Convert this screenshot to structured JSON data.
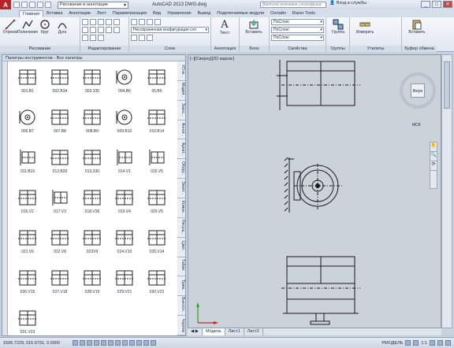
{
  "app": {
    "logo": "A",
    "title": "AutoCAD 2013  DWG.dwg",
    "workspace": "Рисование и аннотации",
    "search_placeholder": "Введите ключевое слово/фразу",
    "signin": "Вход в службы"
  },
  "tabs": [
    "Главная",
    "Вставка",
    "Аннотации",
    "Лист",
    "Параметризация",
    "Вид",
    "Управление",
    "Вывод",
    "Подключаемые модули",
    "Онлайн",
    "Razer Tools"
  ],
  "ribbon": {
    "draw": {
      "title": "Рисование",
      "tools": [
        "Отрезок",
        "Полилиния",
        "Круг",
        "Дуга"
      ]
    },
    "modify": {
      "title": "Редактирование"
    },
    "layers": {
      "title": "Слои",
      "config": "Несохраненная конфигурация сло"
    },
    "annotation": {
      "title": "Аннотация",
      "tool": "Текст"
    },
    "block": {
      "title": "Блок",
      "tool": "Вставить"
    },
    "properties": {
      "title": "Свойства",
      "layer": "ПоСлою",
      "linetype": "ПоСлою",
      "lineweight": "ПоСлою"
    },
    "groups": {
      "title": "Группы",
      "tool": "Группа"
    },
    "utilities": {
      "title": "Утилиты",
      "tool": "Измерить"
    },
    "clipboard": {
      "title": "Буфер обмена",
      "tool": "Вставить"
    }
  },
  "palette": {
    "header": "Палитры инструментов - Все палитры",
    "tabs": [
      "УО м...",
      "Модел...",
      "Закос...",
      "Аннот...",
      "Архит...",
      "Обору...",
      "Элект...",
      "Коман...",
      "Несущ...",
      "Цвет...",
      "Табли...",
      "Трим...",
      "Выносн...",
      "Чертеж"
    ],
    "items": [
      {
        "label": "001.В1",
        "icon": "grid"
      },
      {
        "label": "002.В34",
        "icon": "grid"
      },
      {
        "label": "003.335",
        "icon": "grid"
      },
      {
        "label": "004.В6",
        "icon": "drum"
      },
      {
        "label": "05.В5",
        "icon": "grid"
      },
      {
        "label": "006.В7",
        "icon": "drum"
      },
      {
        "label": "007.В8",
        "icon": "grid"
      },
      {
        "label": "008.В9",
        "icon": "grid"
      },
      {
        "label": "009.В10",
        "icon": "drum"
      },
      {
        "label": "010.В14",
        "icon": "grid"
      },
      {
        "label": "011.В15",
        "icon": "bracket"
      },
      {
        "label": "012.В20",
        "icon": "grid"
      },
      {
        "label": "013.330",
        "icon": "grid"
      },
      {
        "label": "014.V1",
        "icon": "bracket"
      },
      {
        "label": "015.V5",
        "icon": "bracket"
      },
      {
        "label": "016.V2",
        "icon": "grid"
      },
      {
        "label": "017.V3",
        "icon": "bracket"
      },
      {
        "label": "018.V36",
        "icon": "grid"
      },
      {
        "label": "019.V4",
        "icon": "grid"
      },
      {
        "label": "020.V5",
        "icon": "grid"
      },
      {
        "label": "021.V6",
        "icon": "grid"
      },
      {
        "label": "022.V8",
        "icon": "grid"
      },
      {
        "label": "023V9",
        "icon": "grid"
      },
      {
        "label": "024.V10",
        "icon": "grid"
      },
      {
        "label": "025.V14",
        "icon": "grid"
      },
      {
        "label": "026.V15",
        "icon": "grid"
      },
      {
        "label": "027.V18",
        "icon": "grid"
      },
      {
        "label": "028.V19",
        "icon": "grid"
      },
      {
        "label": "029.V21",
        "icon": "grid"
      },
      {
        "label": "030.V22",
        "icon": "grid"
      },
      {
        "label": "031.V23",
        "icon": "grid"
      }
    ]
  },
  "drawing": {
    "view_label": "[–][Сверху][2D каркас]",
    "viewcube_label": "Верх",
    "wcs_label": "МСК"
  },
  "layout_tabs": [
    "Модель",
    "Лист1",
    "Лист2"
  ],
  "status": {
    "coords": "1506.7229, 015.9731, 0.0000",
    "model_label": "РМОДЕЛЬ",
    "scale": "1:1"
  }
}
